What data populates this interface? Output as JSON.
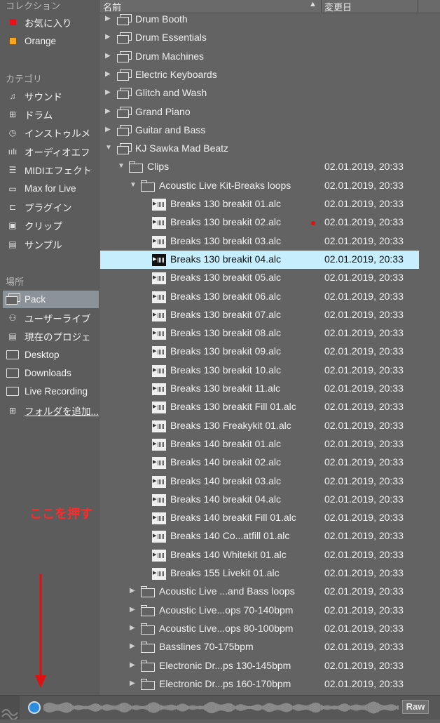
{
  "sidebar": {
    "collections_header": "コレクション",
    "collections": [
      {
        "label": "お気に入り",
        "color": "#e8101a"
      },
      {
        "label": "Orange",
        "color": "#f5a623"
      }
    ],
    "categories_header": "カテゴリ",
    "categories": [
      {
        "label": "サウンド",
        "icon": "note-icon"
      },
      {
        "label": "ドラム",
        "icon": "grid-icon"
      },
      {
        "label": "インストゥルメ",
        "icon": "clock-icon"
      },
      {
        "label": "オーディオエフ",
        "icon": "audio-bars-icon"
      },
      {
        "label": "MIDIエフェクト",
        "icon": "midi-icon"
      },
      {
        "label": "Max for Live",
        "icon": "max-icon"
      },
      {
        "label": "プラグイン",
        "icon": "plug-icon"
      },
      {
        "label": "クリップ",
        "icon": "clip-icon"
      },
      {
        "label": "サンプル",
        "icon": "sample-icon"
      }
    ],
    "places_header": "場所",
    "places": [
      {
        "label": "Pack",
        "icon": "pack-icon",
        "selected": true
      },
      {
        "label": "ユーザーライブ",
        "icon": "user-icon"
      },
      {
        "label": "現在のプロジェ",
        "icon": "project-icon"
      },
      {
        "label": "Desktop",
        "icon": "folder-icon"
      },
      {
        "label": "Downloads",
        "icon": "folder-icon"
      },
      {
        "label": "Live Recording",
        "icon": "folder-icon"
      },
      {
        "label": "フォルダを追加...",
        "icon": "add-folder-icon"
      }
    ]
  },
  "columns": {
    "name": "名前",
    "date": "変更日"
  },
  "rows": [
    {
      "name": "Drum Booth",
      "type": "pack",
      "indent": 0,
      "arrow": "▶",
      "date": ""
    },
    {
      "name": "Drum Essentials",
      "type": "pack",
      "indent": 0,
      "arrow": "▶",
      "date": ""
    },
    {
      "name": "Drum Machines",
      "type": "pack",
      "indent": 0,
      "arrow": "▶",
      "date": ""
    },
    {
      "name": "Electric Keyboards",
      "type": "pack",
      "indent": 0,
      "arrow": "▶",
      "date": ""
    },
    {
      "name": "Glitch and Wash",
      "type": "pack",
      "indent": 0,
      "arrow": "▶",
      "date": ""
    },
    {
      "name": "Grand Piano",
      "type": "pack",
      "indent": 0,
      "arrow": "▶",
      "date": ""
    },
    {
      "name": "Guitar and Bass",
      "type": "pack",
      "indent": 0,
      "arrow": "▶",
      "date": ""
    },
    {
      "name": "KJ Sawka Mad Beatz",
      "type": "pack",
      "indent": 0,
      "arrow": "▼",
      "date": ""
    },
    {
      "name": "Clips",
      "type": "folder",
      "indent": 1,
      "arrow": "▼",
      "date": "02.01.2019, 20:33"
    },
    {
      "name": "Acoustic Live Kit-Breaks loops",
      "type": "folder",
      "indent": 2,
      "arrow": "▼",
      "date": "02.01.2019, 20:33"
    },
    {
      "name": "Breaks 130 breakit 01.alc",
      "type": "clip",
      "indent": 3,
      "date": "02.01.2019, 20:33"
    },
    {
      "name": "Breaks 130 breakit 02.alc",
      "type": "clip",
      "indent": 3,
      "date": "02.01.2019, 20:33",
      "marker": true
    },
    {
      "name": "Breaks 130 breakit 03.alc",
      "type": "clip",
      "indent": 3,
      "date": "02.01.2019, 20:33"
    },
    {
      "name": "Breaks 130 breakit 04.alc",
      "type": "clip",
      "indent": 3,
      "date": "02.01.2019, 20:33",
      "selected": true
    },
    {
      "name": "Breaks 130 breakit 05.alc",
      "type": "clip",
      "indent": 3,
      "date": "02.01.2019, 20:33"
    },
    {
      "name": "Breaks 130 breakit 06.alc",
      "type": "clip",
      "indent": 3,
      "date": "02.01.2019, 20:33"
    },
    {
      "name": "Breaks 130 breakit 07.alc",
      "type": "clip",
      "indent": 3,
      "date": "02.01.2019, 20:33"
    },
    {
      "name": "Breaks 130 breakit 08.alc",
      "type": "clip",
      "indent": 3,
      "date": "02.01.2019, 20:33"
    },
    {
      "name": "Breaks 130 breakit 09.alc",
      "type": "clip",
      "indent": 3,
      "date": "02.01.2019, 20:33"
    },
    {
      "name": "Breaks 130 breakit 10.alc",
      "type": "clip",
      "indent": 3,
      "date": "02.01.2019, 20:33"
    },
    {
      "name": "Breaks 130 breakit 11.alc",
      "type": "clip",
      "indent": 3,
      "date": "02.01.2019, 20:33"
    },
    {
      "name": "Breaks 130 breakit Fill 01.alc",
      "type": "clip",
      "indent": 3,
      "date": "02.01.2019, 20:33"
    },
    {
      "name": "Breaks 130 Freakykit 01.alc",
      "type": "clip",
      "indent": 3,
      "date": "02.01.2019, 20:33"
    },
    {
      "name": "Breaks 140 breakit 01.alc",
      "type": "clip",
      "indent": 3,
      "date": "02.01.2019, 20:33"
    },
    {
      "name": "Breaks 140 breakit 02.alc",
      "type": "clip",
      "indent": 3,
      "date": "02.01.2019, 20:33"
    },
    {
      "name": "Breaks 140 breakit 03.alc",
      "type": "clip",
      "indent": 3,
      "date": "02.01.2019, 20:33"
    },
    {
      "name": "Breaks 140 breakit 04.alc",
      "type": "clip",
      "indent": 3,
      "date": "02.01.2019, 20:33"
    },
    {
      "name": "Breaks 140 breakit Fill 01.alc",
      "type": "clip",
      "indent": 3,
      "date": "02.01.2019, 20:33"
    },
    {
      "name": "Breaks 140 Co...atfill 01.alc",
      "type": "clip",
      "indent": 3,
      "date": "02.01.2019, 20:33"
    },
    {
      "name": "Breaks 140 Whitekit 01.alc",
      "type": "clip",
      "indent": 3,
      "date": "02.01.2019, 20:33"
    },
    {
      "name": "Breaks 155 Livekit 01.alc",
      "type": "clip",
      "indent": 3,
      "date": "02.01.2019, 20:33"
    },
    {
      "name": "Acoustic Live ...and Bass loops",
      "type": "folder",
      "indent": 2,
      "arrow": "▶",
      "date": "02.01.2019, 20:33"
    },
    {
      "name": "Acoustic Live...ops 70-140bpm",
      "type": "folder",
      "indent": 2,
      "arrow": "▶",
      "date": "02.01.2019, 20:33"
    },
    {
      "name": "Acoustic Live...ops 80-100bpm",
      "type": "folder",
      "indent": 2,
      "arrow": "▶",
      "date": "02.01.2019, 20:33"
    },
    {
      "name": "Basslines 70-175bpm",
      "type": "folder",
      "indent": 2,
      "arrow": "▶",
      "date": "02.01.2019, 20:33"
    },
    {
      "name": "Electronic Dr...ps 130-145bpm",
      "type": "folder",
      "indent": 2,
      "arrow": "▶",
      "date": "02.01.2019, 20:33"
    },
    {
      "name": "Electronic Dr...ps 160-170bpm",
      "type": "folder",
      "indent": 2,
      "arrow": "▶",
      "date": "02.01.2019, 20:33"
    }
  ],
  "annotation": "ここを押す",
  "bottom": {
    "raw_label": "Raw"
  }
}
